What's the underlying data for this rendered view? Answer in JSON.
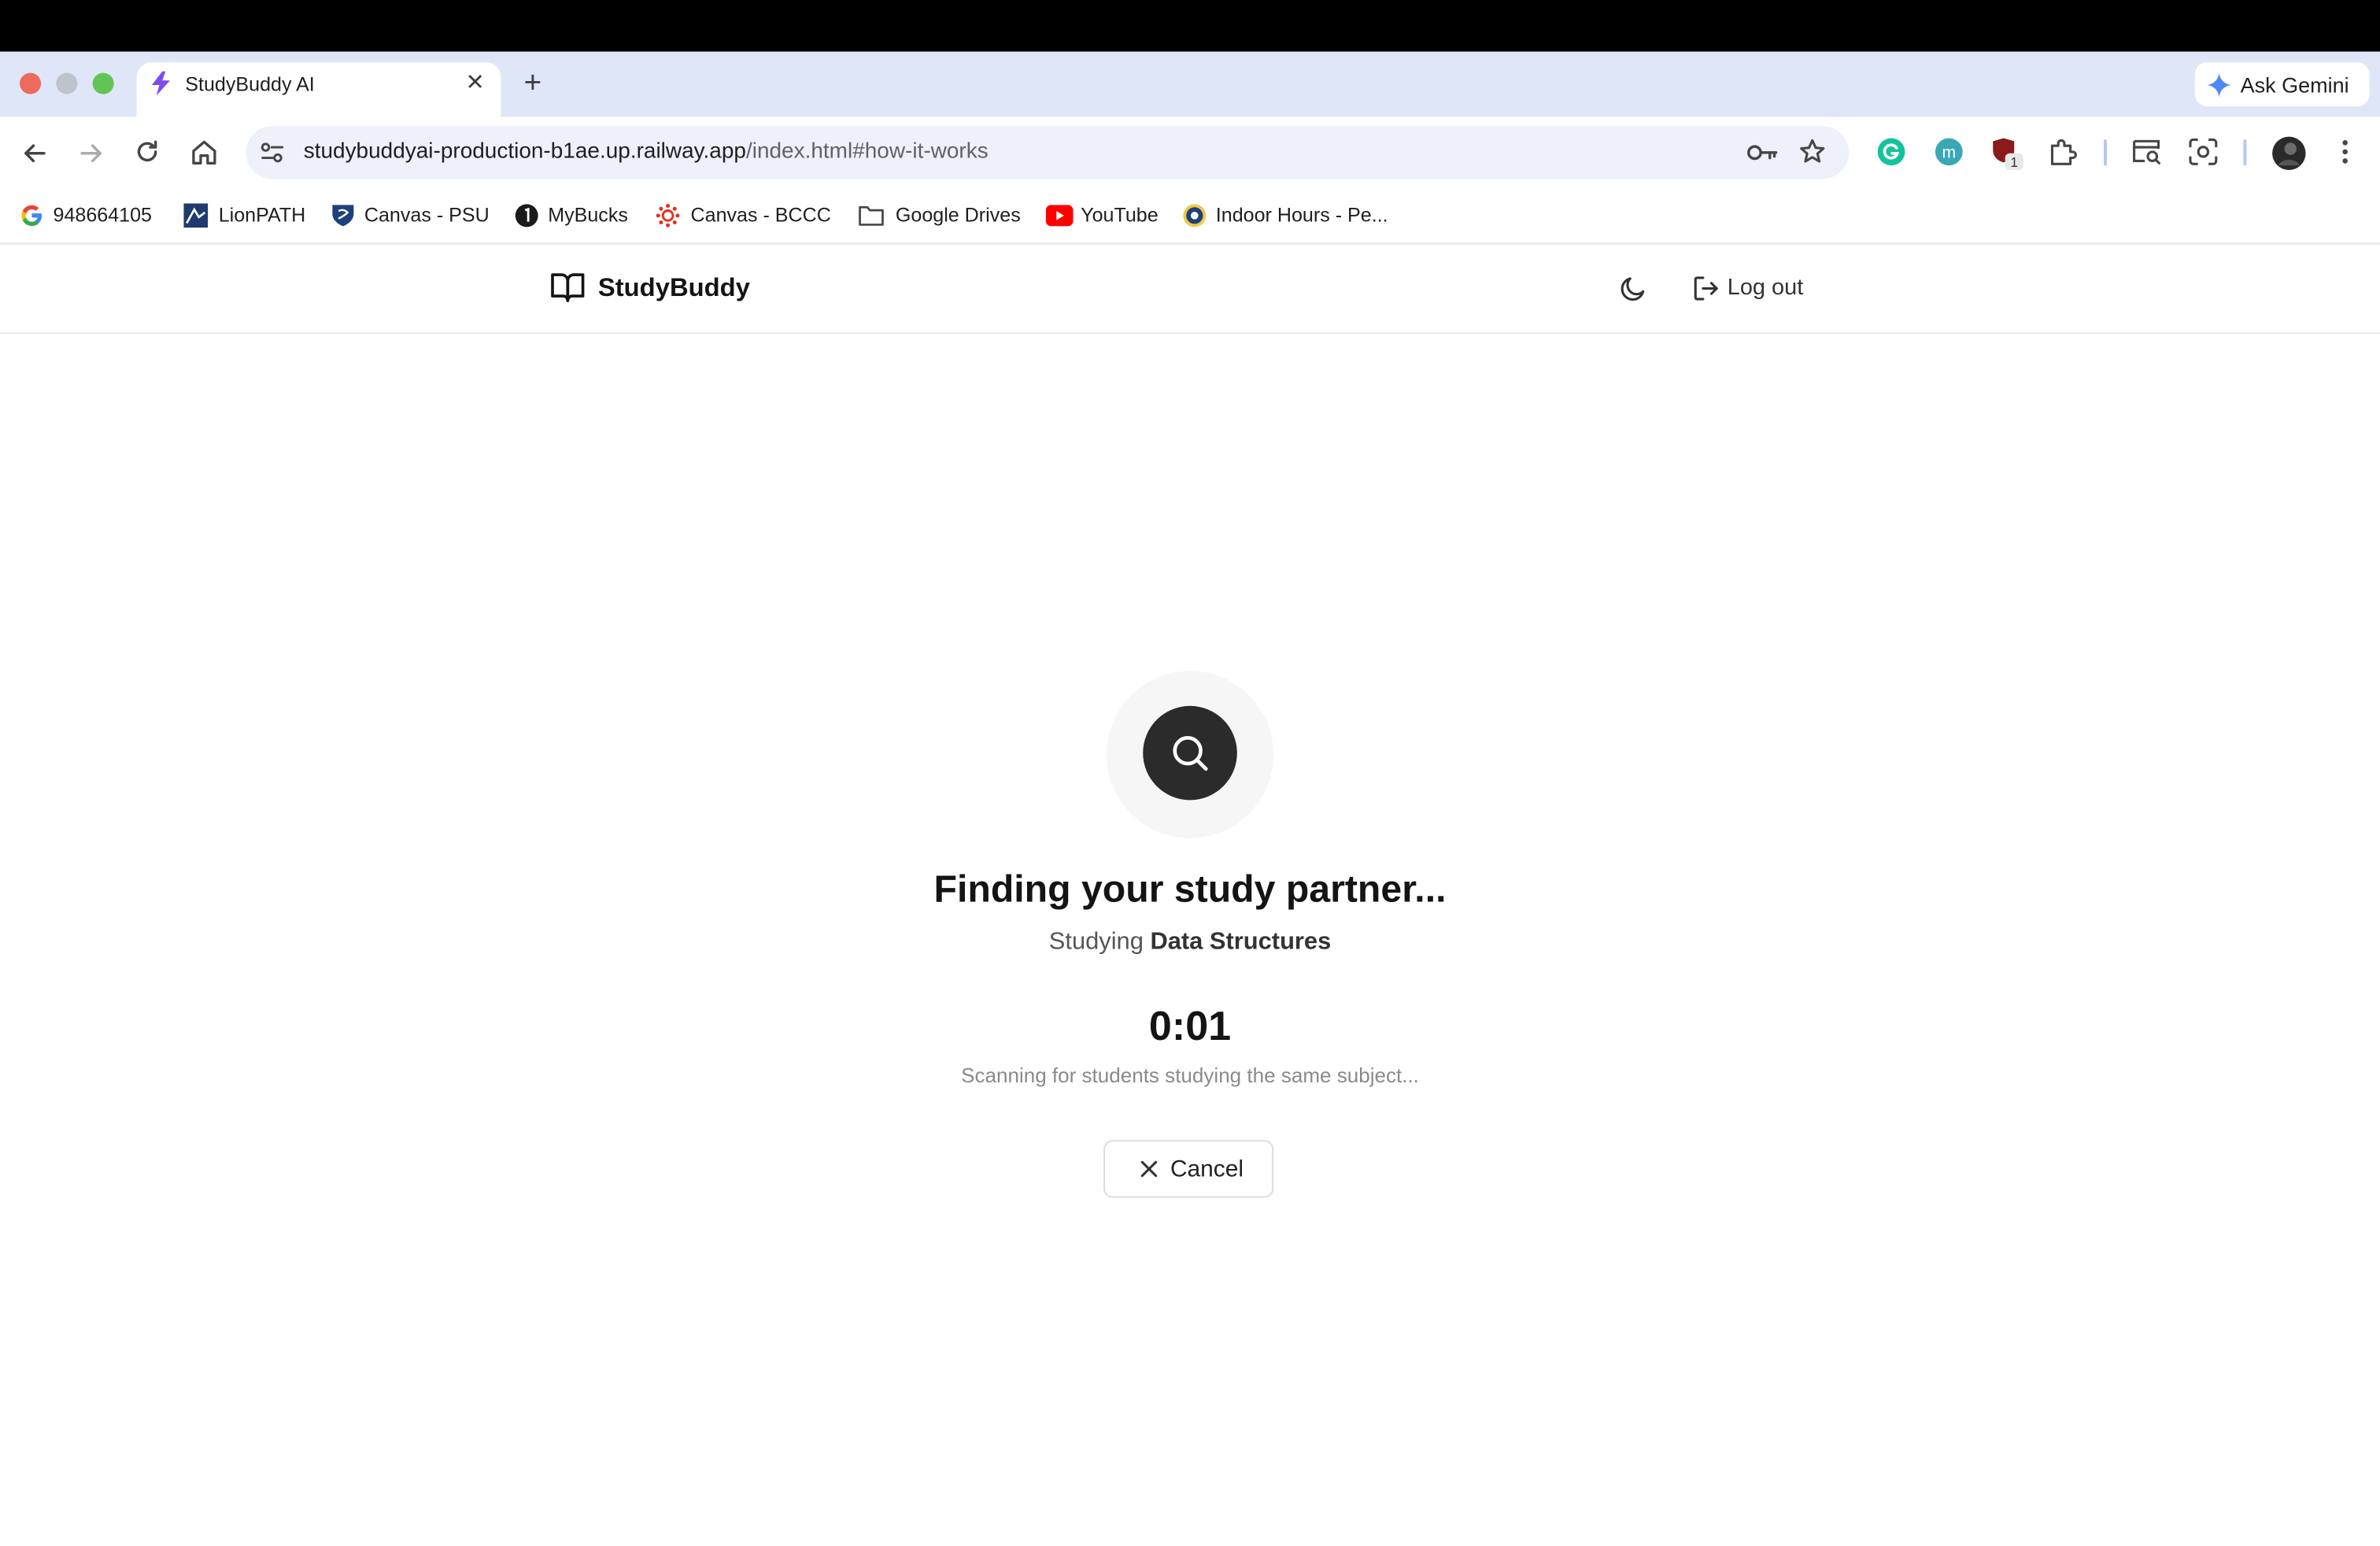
{
  "browser": {
    "tab_title": "StudyBuddy AI",
    "new_tab_icon": "plus-icon",
    "gemini_label": "Ask Gemini",
    "url_host": "studybuddyai-production-b1ae.up.railway.app",
    "url_path": "/index.html#how-it-works",
    "extension_badge": "1",
    "extension_letter": "m",
    "bookmarks": [
      {
        "label": "948664105",
        "icon": "google-icon"
      },
      {
        "label": "LionPATH",
        "icon": "lionpath-icon"
      },
      {
        "label": "Canvas - PSU",
        "icon": "psu-shield-icon"
      },
      {
        "label": "MyBucks",
        "icon": "mybucks-icon"
      },
      {
        "label": "Canvas - BCCC",
        "icon": "canvas-icon"
      },
      {
        "label": "Google Drives",
        "icon": "folder-icon"
      },
      {
        "label": "YouTube",
        "icon": "youtube-icon"
      },
      {
        "label": "Indoor Hours - Pe...",
        "icon": "indoor-hours-icon"
      }
    ]
  },
  "app": {
    "brand": "StudyBuddy",
    "logout_label": "Log out",
    "theme_icon": "moon-icon"
  },
  "matching": {
    "heading": "Finding your study partner...",
    "subject_prefix": "Studying",
    "subject": "Data Structures",
    "timer": "0:01",
    "status": "Scanning for students studying the same subject...",
    "cancel_label": "Cancel"
  },
  "colors": {
    "tabstrip": "#dfe6f7",
    "omnibox": "#edf1f9",
    "search_badge": "#2b2b2b",
    "halo": "#f6f6f6"
  }
}
